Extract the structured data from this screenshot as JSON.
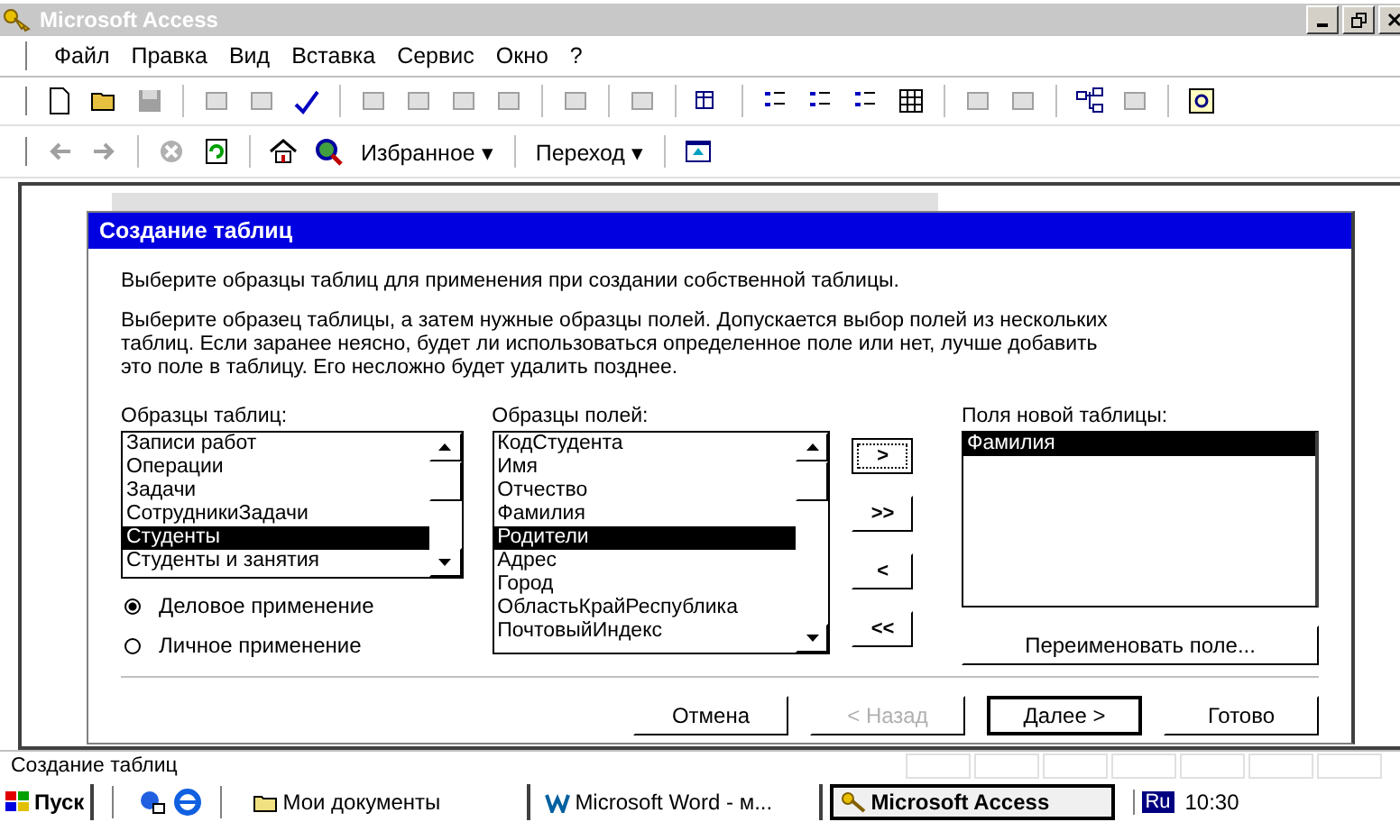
{
  "app": {
    "title": "Microsoft Access",
    "active": false
  },
  "menu": [
    "Файл",
    "Правка",
    "Вид",
    "Вставка",
    "Сервис",
    "Окно",
    "?"
  ],
  "web_toolbar": {
    "favorites": "Избранное ▾",
    "go": "Переход ▾"
  },
  "dialog": {
    "title": "Создание таблиц",
    "intro": "Выберите образцы таблиц для применения при создании собственной таблицы.",
    "instructions": "Выберите образец таблицы, а затем нужные образцы полей. Допускается выбор полей из нескольких\nтаблиц. Если заранее неясно, будет ли использоваться определенное поле или нет, лучше добавить\nэто поле в таблицу. Его несложно будет удалить позднее.",
    "sample_tables": {
      "label": "Образцы таблиц:",
      "items": [
        {
          "text": "Записи работ",
          "selected": false
        },
        {
          "text": "Операции",
          "selected": false
        },
        {
          "text": "Задачи",
          "selected": false
        },
        {
          "text": "СотрудникиЗадачи",
          "selected": false
        },
        {
          "text": "Студенты",
          "selected": true
        },
        {
          "text": "Студенты и занятия",
          "selected": false
        }
      ]
    },
    "usage": [
      {
        "label": "Деловое применение",
        "selected": true
      },
      {
        "label": "Личное применение",
        "selected": false
      }
    ],
    "sample_fields": {
      "label": "Образцы полей:",
      "items": [
        {
          "text": "КодСтудента",
          "selected": false
        },
        {
          "text": "Имя",
          "selected": false
        },
        {
          "text": "Отчество",
          "selected": false
        },
        {
          "text": "Фамилия",
          "selected": false
        },
        {
          "text": "Родители",
          "selected": true
        },
        {
          "text": "Адрес",
          "selected": false
        },
        {
          "text": "Город",
          "selected": false
        },
        {
          "text": "ОбластьКрайРеспублика",
          "selected": false
        },
        {
          "text": "ПочтовыйИндекс",
          "selected": false
        }
      ]
    },
    "move_buttons": [
      {
        "label": ">",
        "focused": true
      },
      {
        "label": ">>",
        "focused": false
      },
      {
        "label": "<",
        "focused": false
      },
      {
        "label": "<<",
        "focused": false
      }
    ],
    "new_fields": {
      "label": "Поля новой таблицы:",
      "items": [
        {
          "text": "Фамилия",
          "selected": true
        }
      ]
    },
    "rename_button": "Переименовать поле...",
    "buttons": [
      {
        "label": "Отмена",
        "disabled": false,
        "default": false
      },
      {
        "label": "< Назад",
        "disabled": true,
        "default": false
      },
      {
        "label": "Далее >",
        "disabled": false,
        "default": true
      },
      {
        "label": "Готово",
        "disabled": false,
        "default": false
      }
    ]
  },
  "status_bar": "Создание таблиц",
  "taskbar": {
    "start": "Пуск",
    "tasks": [
      {
        "label": "Мои документы",
        "selected": false
      },
      {
        "label": "Microsoft Word - м...",
        "selected": false
      },
      {
        "label": "Microsoft Access",
        "selected": true
      }
    ],
    "language": "Ru",
    "clock": "10:30"
  }
}
